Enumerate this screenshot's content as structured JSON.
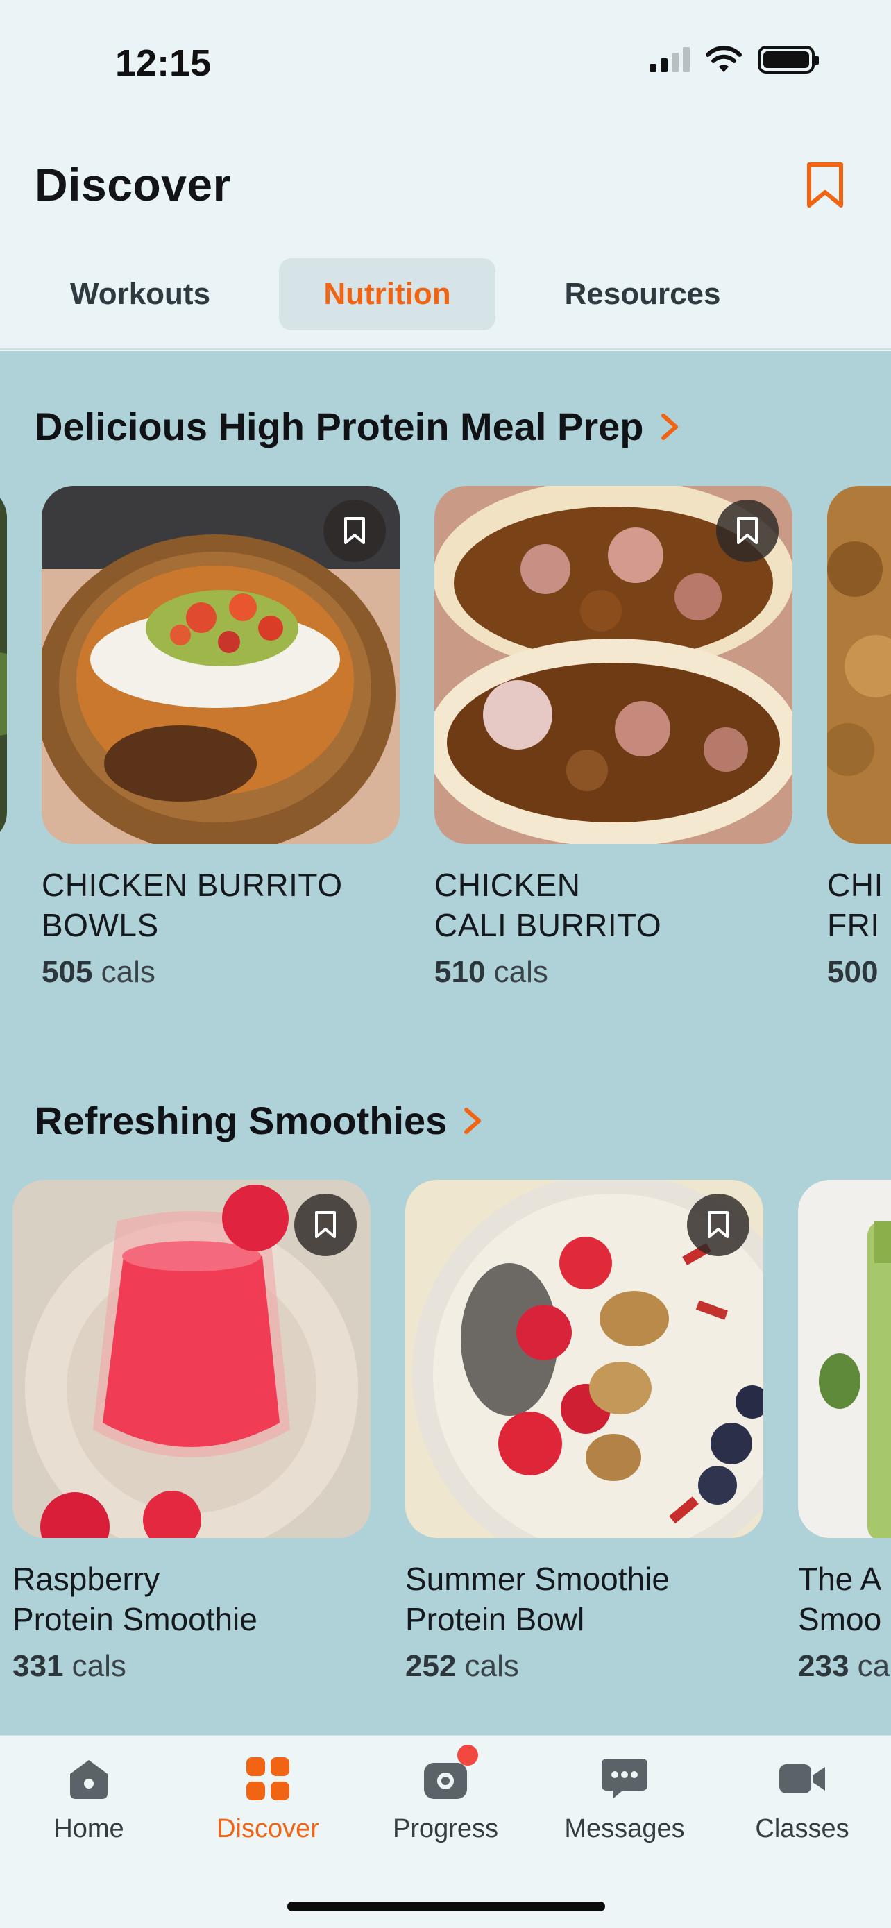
{
  "status": {
    "time": "12:15"
  },
  "header": {
    "title": "Discover",
    "tabs": [
      {
        "label": "Workouts",
        "active": false
      },
      {
        "label": "Nutrition",
        "active": true
      },
      {
        "label": "Resources",
        "active": false
      }
    ]
  },
  "colors": {
    "accent": "#f06414",
    "content_bg": "#aed2d8",
    "header_bg": "#eaf4f7"
  },
  "sections": [
    {
      "title": "Delicious High Protein Meal Prep",
      "cards": [
        {
          "title": "CHICKEN BURRITO\nBOWLS",
          "cals_value": "505",
          "cals_unit": "cals"
        },
        {
          "title": "CHICKEN\nCALI BURRITO",
          "cals_value": "510",
          "cals_unit": "cals"
        },
        {
          "title": "CHI\nFRI",
          "cals_value": "500",
          "cals_unit": ""
        }
      ]
    },
    {
      "title": "Refreshing Smoothies",
      "cards": [
        {
          "title": "Raspberry\nProtein Smoothie",
          "cals_value": "331",
          "cals_unit": "cals"
        },
        {
          "title": "Summer Smoothie\nProtein Bowl",
          "cals_value": "252",
          "cals_unit": "cals"
        },
        {
          "title": "The A\nSmoo",
          "cals_value": "233",
          "cals_unit": "ca"
        }
      ]
    }
  ],
  "nav": [
    {
      "label": "Home",
      "icon": "home-icon",
      "active": false
    },
    {
      "label": "Discover",
      "icon": "grid-icon",
      "active": true
    },
    {
      "label": "Progress",
      "icon": "camera-icon",
      "active": false,
      "badge": true
    },
    {
      "label": "Messages",
      "icon": "chat-bubble-icon",
      "active": false
    },
    {
      "label": "Classes",
      "icon": "video-camera-icon",
      "active": false
    }
  ]
}
